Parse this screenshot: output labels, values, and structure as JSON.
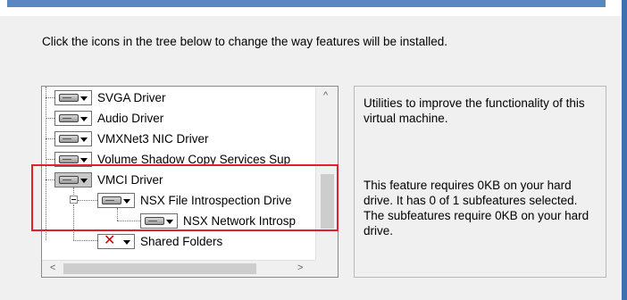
{
  "instruction": "Click the icons in the tree below to change the way features will be installed.",
  "tree": {
    "items": [
      {
        "label": "SVGA Driver",
        "state": "installed"
      },
      {
        "label": "Audio Driver",
        "state": "installed"
      },
      {
        "label": "VMXNet3 NIC Driver",
        "state": "installed"
      },
      {
        "label": "Volume Shadow Copy Services Sup",
        "state": "installed"
      },
      {
        "label": "VMCI Driver",
        "state": "installed",
        "selected": true,
        "expanded": true
      },
      {
        "label": "NSX File Introspection Drive",
        "state": "installed",
        "expanded": true
      },
      {
        "label": "NSX Network Introsp",
        "state": "installed"
      },
      {
        "label": "Shared Folders",
        "state": "not-installed"
      }
    ],
    "scroll_up_symbol": "^",
    "scroll_left_symbol": "<",
    "scroll_right_symbol": ">"
  },
  "description": {
    "summary": "Utilities to improve the functionality of this virtual machine.",
    "requirements": "This feature requires 0KB on your hard drive. It has 0 of 1 subfeatures selected. The subfeatures require 0KB on your hard drive."
  },
  "colors": {
    "highlight_border": "#e0202a",
    "title_accent": "#5a86c2",
    "not_installed_x": "#d40000"
  }
}
